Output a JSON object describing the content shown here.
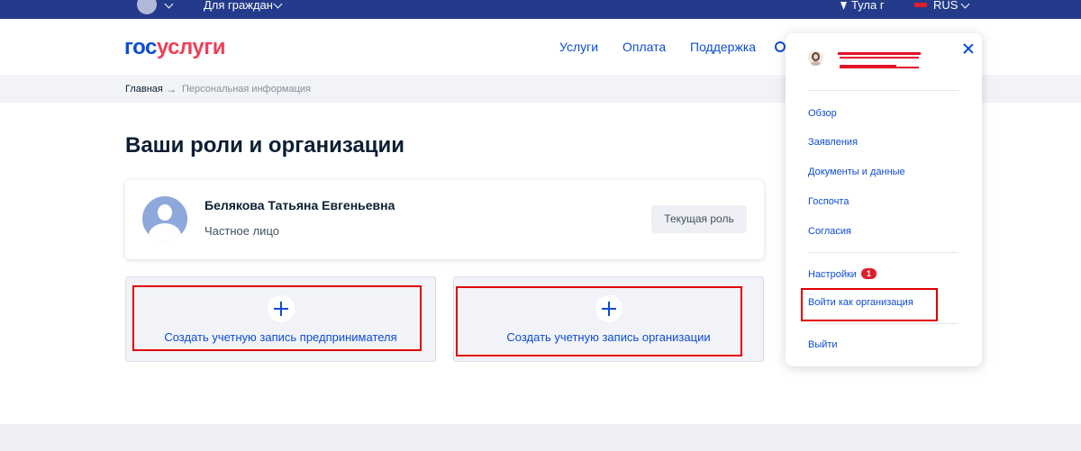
{
  "topbar": {
    "citizens_label": "Для граждан",
    "city_label": "Тула г",
    "language_label": "RUS"
  },
  "header": {
    "logo_part1": "гос",
    "logo_part2": "услуги",
    "nav": [
      "Услуги",
      "Оплата",
      "Поддержка"
    ]
  },
  "breadcrumb": {
    "home": "Главная",
    "arrow": "→",
    "current": "Персональная информация"
  },
  "page": {
    "title": "Ваши роли и организации"
  },
  "profile": {
    "name": "Белякова Татьяна Евгеньевна",
    "type": "Частное лицо",
    "role_button": "Текущая роль"
  },
  "tiles": [
    {
      "label": "Создать учетную запись предпринимателя"
    },
    {
      "label": "Создать учетную запись организации"
    }
  ],
  "dropdown": {
    "items": [
      "Обзор",
      "Заявления",
      "Документы и данные",
      "Госпочта",
      "Согласия"
    ],
    "settings_label": "Настройки",
    "settings_badge": "1",
    "login_as_org": "Войти как организация",
    "logout": "Выйти"
  },
  "colors": {
    "topbar": "#233b8a",
    "accent": "#0d4cd3",
    "logo_red": "#ee3f58",
    "highlight": "#e20000"
  }
}
